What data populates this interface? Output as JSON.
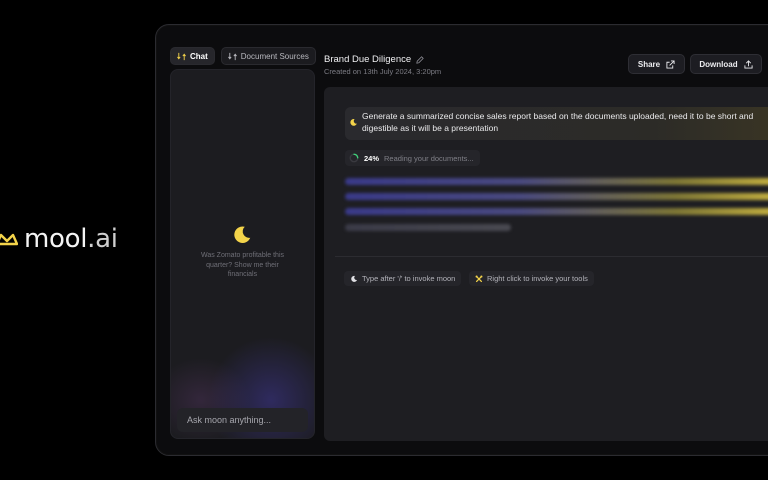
{
  "brand": {
    "name_main": "mool",
    "name_suffix": ".ai"
  },
  "tabs": [
    {
      "label": "Chat",
      "icon": "swap-icon",
      "active": true
    },
    {
      "label": "Document Sources",
      "icon": "swap-icon",
      "active": false
    }
  ],
  "chat": {
    "hint": "Was Zomato profitable this quarter? Show me their financials",
    "input_placeholder": "Ask moon anything..."
  },
  "header": {
    "title": "Brand Due Diligence",
    "created": "Created on 13th July 2024, 3:20pm",
    "share_label": "Share",
    "download_label": "Download"
  },
  "prompt": {
    "text": "Generate a summarized concise sales report based on the documents uploaded, need it to be short and digestible as it will be a presentation"
  },
  "status": {
    "percent": "24%",
    "progress": 0.24,
    "text": "Reading your documents..."
  },
  "chips": {
    "invoke_moon": "Type after '/' to invoke moon",
    "invoke_tools": "Right click to invoke your tools"
  },
  "colors": {
    "accent": "#f3d34a",
    "background": "#000000",
    "panel": "#1e1e22"
  }
}
